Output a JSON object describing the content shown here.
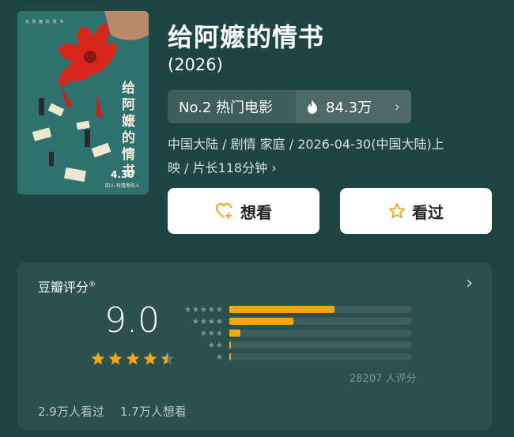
{
  "poster": {
    "vertical_title": "给阿嬷的情书",
    "date": "4.30",
    "subtitle": "四人·有情等你人",
    "top_line": "给 阿 嬷 的 情 书"
  },
  "movie": {
    "title": "给阿嬷的情书",
    "year": "(2026)",
    "rank_label": "No.2 热门电影",
    "heat_value": "84.3万",
    "meta_line1": "中国大陆 / 剧情 家庭 / 2026-04-30(中国大陆)上",
    "meta_line2": "映 / 片长118分钟 ›"
  },
  "buttons": {
    "want_label": "想看",
    "seen_label": "看过"
  },
  "rating": {
    "title": "豆瓣评分",
    "reg_mark": "®",
    "score": "9.0",
    "star_level": 4.5,
    "distribution": [
      {
        "stars": 5,
        "fraction": 0.58
      },
      {
        "stars": 4,
        "fraction": 0.35
      },
      {
        "stars": 3,
        "fraction": 0.06
      },
      {
        "stars": 2,
        "fraction": 0.01
      },
      {
        "stars": 1,
        "fraction": 0.005
      }
    ],
    "total_votes": "28207 人评分",
    "watched": "2.9万人看过",
    "want": "1.7万人想看"
  },
  "colors": {
    "background": "#1f4543",
    "card": "#2b504e",
    "accent_star": "#f3a712"
  },
  "icons": {
    "fire": "fire-icon",
    "heart_plus": "heart-plus-icon",
    "star_outline": "star-outline-icon",
    "chevron": "chevron-right-icon"
  }
}
